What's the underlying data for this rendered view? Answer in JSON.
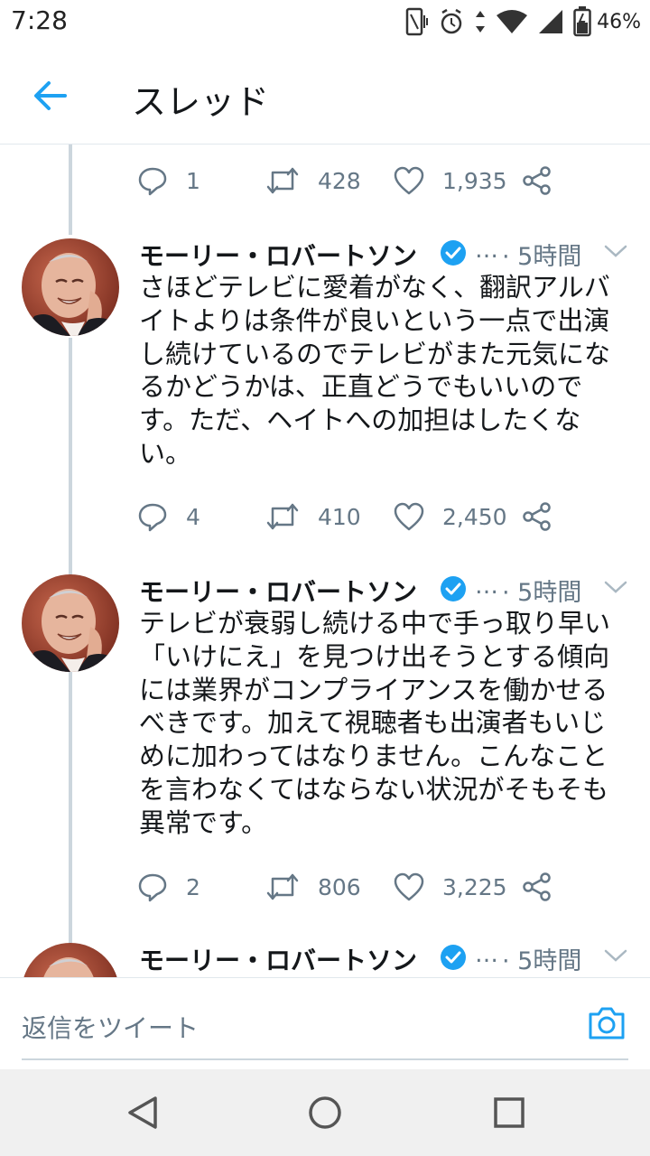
{
  "status_bar": {
    "time": "7:28",
    "battery": "46%"
  },
  "header": {
    "title": "スレッド",
    "back_icon": "arrow-left-icon"
  },
  "top_actions": {
    "replies": "1",
    "retweets": "428",
    "likes": "1,935"
  },
  "tweets": [
    {
      "author": "モーリー・ロバートソン",
      "ellipsis": "…",
      "time": "· 5時間",
      "lines": [
        "さほどテレビに愛着がなく、翻訳アルバ",
        "イトよりは条件が良いという一点で出演",
        "し続けているのでテレビがまた元気にな",
        "るかどうかは、正直どうでもいいので",
        "す。ただ、ヘイトへの加担はしたくな",
        "い。"
      ],
      "replies": "4",
      "retweets": "410",
      "likes": "2,450"
    },
    {
      "author": "モーリー・ロバートソン",
      "ellipsis": "…",
      "time": "· 5時間",
      "lines": [
        "テレビが衰弱し続ける中で手っ取り早い",
        "「いけにえ」を見つけ出そうとする傾向",
        "には業界がコンプライアンスを働かせる",
        "べきです。加えて視聴者も出演者もいじ",
        "めに加わってはなりません。こんなこと",
        "を言わなくてはならない状況がそもそも",
        "異常です。"
      ],
      "replies": "2",
      "retweets": "806",
      "likes": "3,225"
    },
    {
      "author": "モーリー・ロバートソン",
      "ellipsis": "…",
      "time": "· 5時間"
    }
  ],
  "reply_bar": {
    "placeholder": "返信をツイート"
  },
  "colors": {
    "accent": "#1da1f2",
    "secondary_text": "#657786",
    "primary_text": "#14171a"
  }
}
